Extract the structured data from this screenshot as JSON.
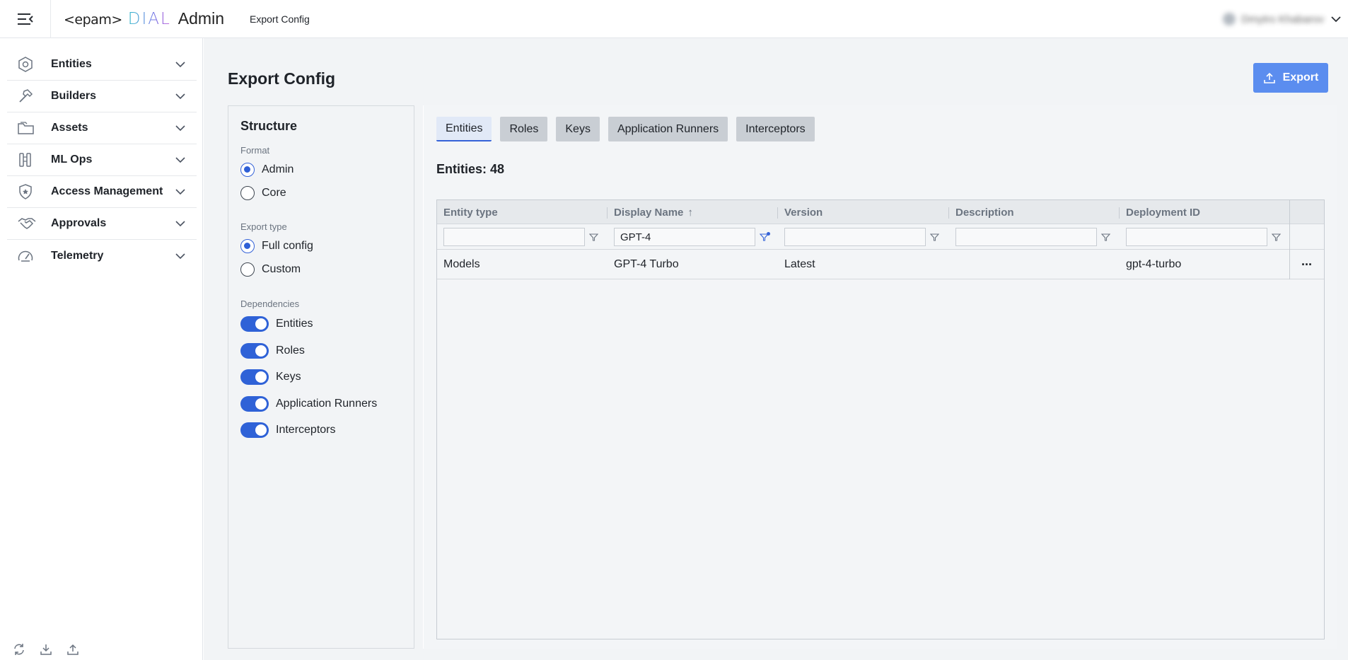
{
  "header": {
    "logo_epam": "<epam>",
    "logo_dial": "DIAL",
    "logo_admin": "Admin",
    "breadcrumb": "Export Config",
    "user_name": "Dmytro Khabarov",
    "icons": {
      "menu": "menu-collapse-icon",
      "user": "chevron-down-icon"
    }
  },
  "sidebar": {
    "items": [
      {
        "label": "Entities",
        "icon": "hexagon-icon"
      },
      {
        "label": "Builders",
        "icon": "hammer-icon"
      },
      {
        "label": "Assets",
        "icon": "folder-icon"
      },
      {
        "label": "ML Ops",
        "icon": "ml-ops-icon"
      },
      {
        "label": "Access Management",
        "icon": "shield-icon"
      },
      {
        "label": "Approvals",
        "icon": "handshake-icon"
      },
      {
        "label": "Telemetry",
        "icon": "gauge-icon"
      }
    ],
    "bottom_icons": [
      "refresh-icon",
      "download-icon",
      "upload-icon"
    ]
  },
  "main": {
    "title": "Export Config",
    "export_button": "Export",
    "accent_color": "#5b8def"
  },
  "structure": {
    "title": "Structure",
    "format_label": "Format",
    "format_options": [
      "Admin",
      "Core"
    ],
    "format_selected": "Admin",
    "export_type_label": "Export type",
    "export_type_options": [
      "Full config",
      "Custom"
    ],
    "export_type_selected": "Full config",
    "dependencies_label": "Dependencies",
    "dependencies": [
      {
        "label": "Entities",
        "on": true
      },
      {
        "label": "Roles",
        "on": true
      },
      {
        "label": "Keys",
        "on": true
      },
      {
        "label": "Application Runners",
        "on": true
      },
      {
        "label": "Interceptors",
        "on": true
      }
    ]
  },
  "tabs": [
    {
      "label": "Entities",
      "active": true
    },
    {
      "label": "Roles",
      "active": false
    },
    {
      "label": "Keys",
      "active": false
    },
    {
      "label": "Application Runners",
      "active": false
    },
    {
      "label": "Interceptors",
      "active": false
    }
  ],
  "entities_count": "Entities: 48",
  "grid": {
    "columns": [
      "Entity type",
      "Display Name",
      "Version",
      "Description",
      "Deployment ID"
    ],
    "sort_indicator": "↑",
    "filters": [
      "",
      "GPT-4",
      "",
      "",
      ""
    ],
    "rows": [
      {
        "entity_type": "Models",
        "display_name": "GPT-4 Turbo",
        "version": "Latest",
        "description": "",
        "deployment_id": "gpt-4-turbo"
      }
    ],
    "row_actions": "···"
  }
}
